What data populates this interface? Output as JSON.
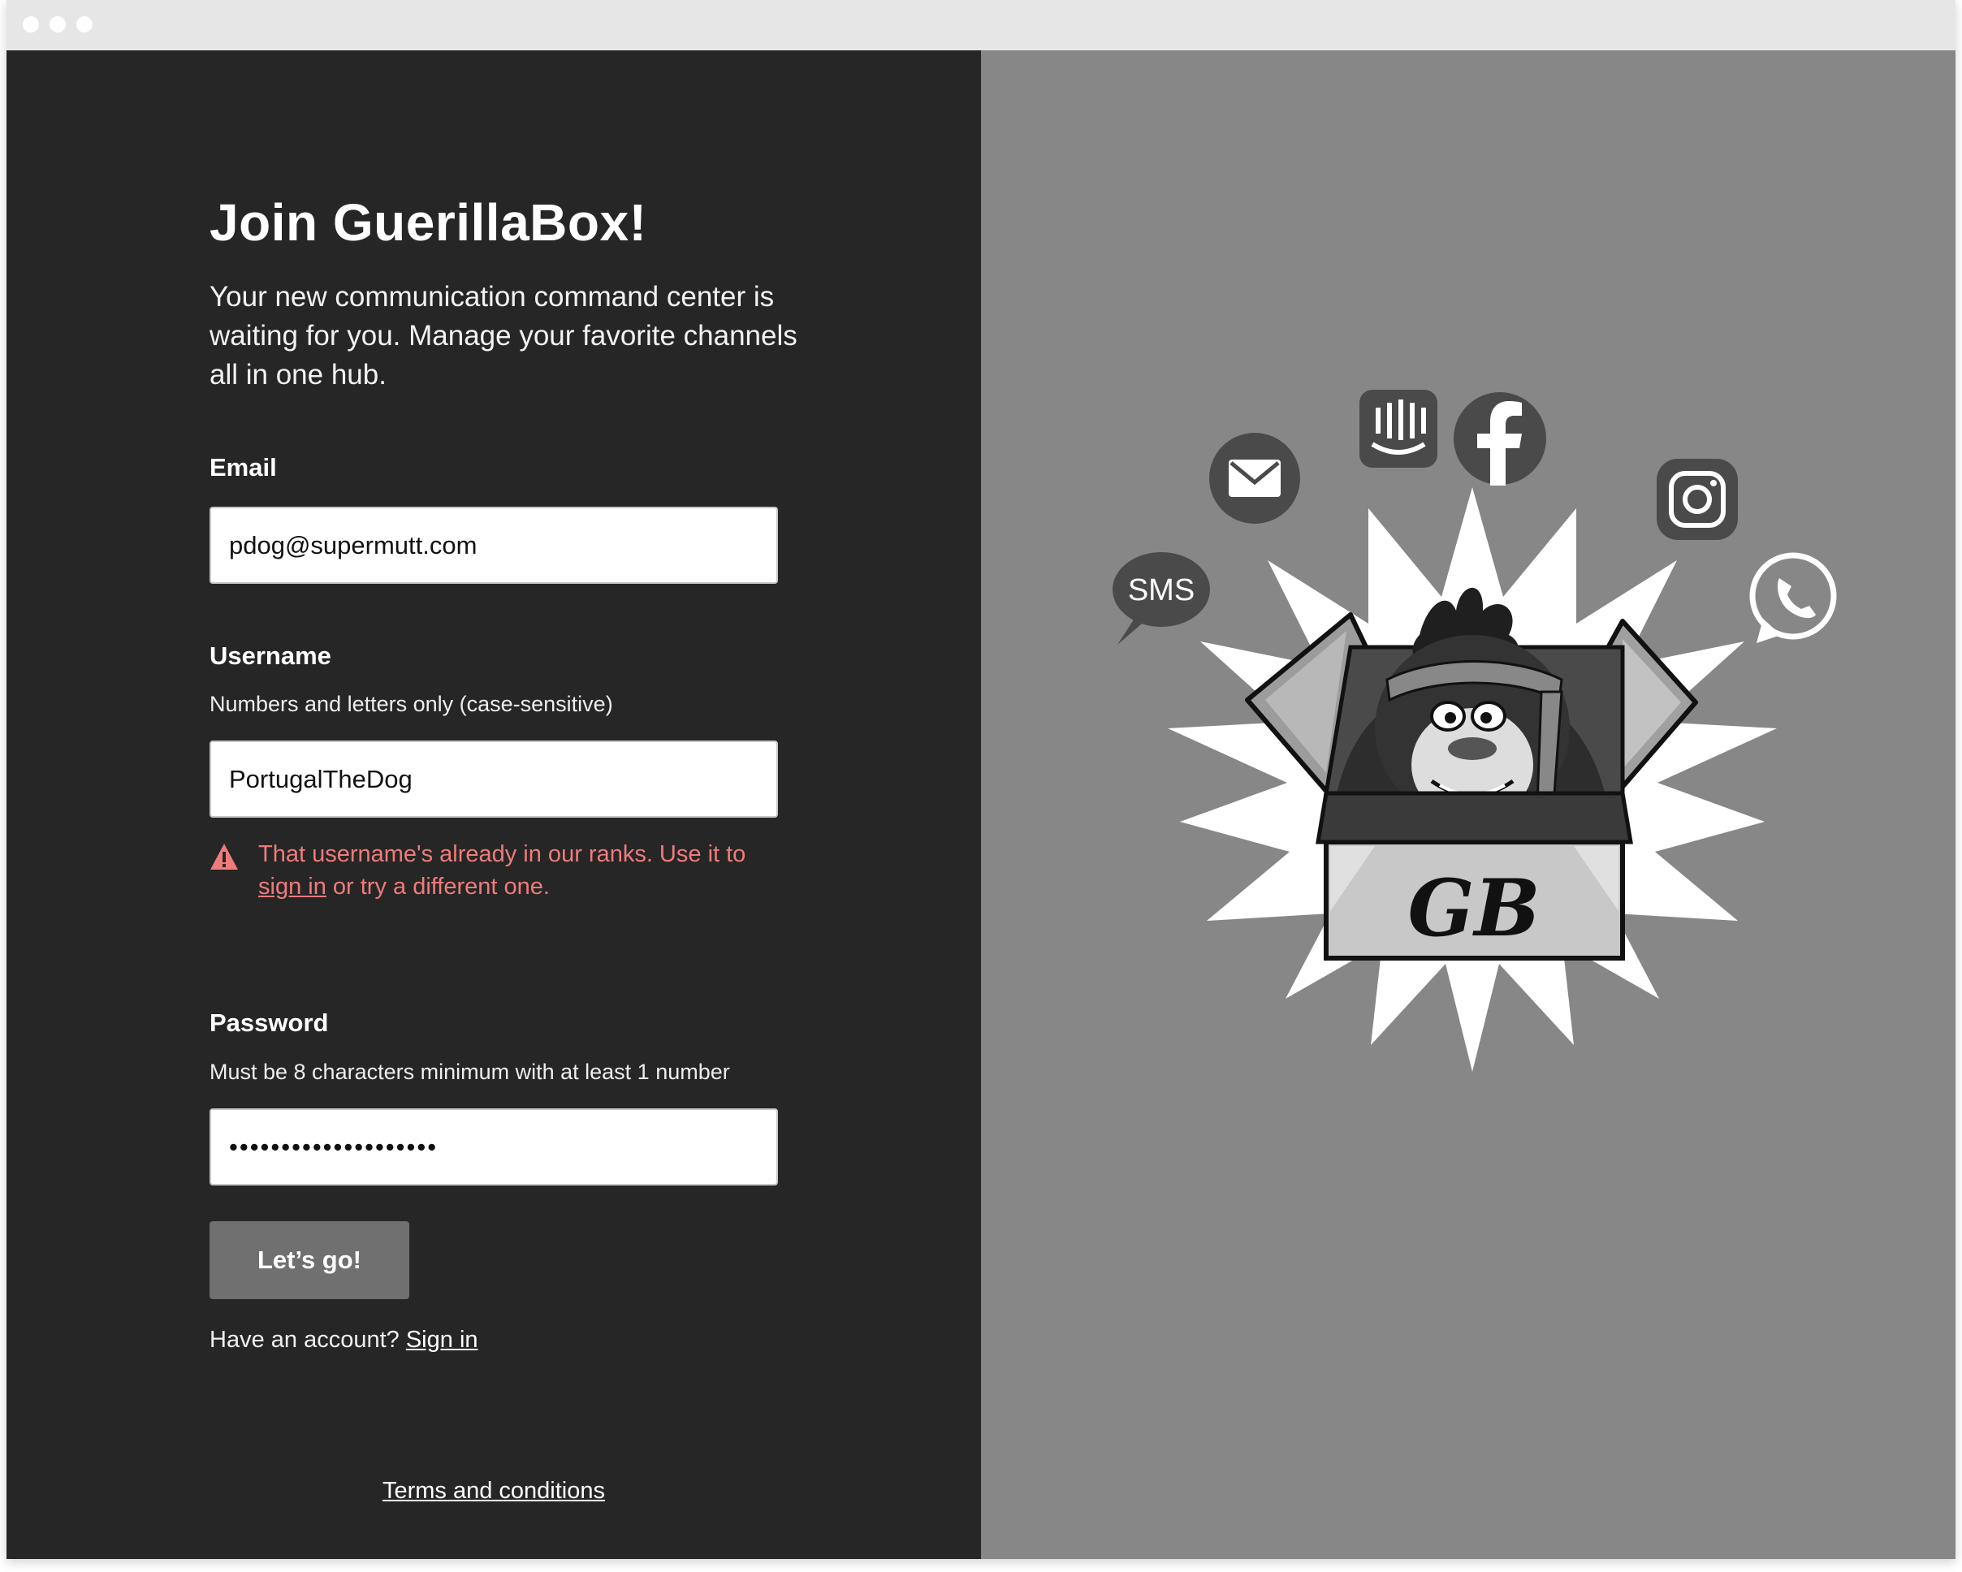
{
  "signup": {
    "title": "Join GuerillaBox!",
    "subtitle": "Your new communication command center is waiting for you. Manage your favorite channels all in one hub.",
    "email": {
      "label": "Email",
      "value": "pdog@supermutt.com"
    },
    "username": {
      "label": "Username",
      "hint": "Numbers and letters only (case-sensitive)",
      "value": "PortugalTheDog",
      "error_before": "That username's already in our ranks. Use it to",
      "error_link": "sign in",
      "error_after": "or try a different one."
    },
    "password": {
      "label": "Password",
      "hint": "Must be 8 characters minimum with at least 1 number",
      "value": "••••••••••••••••••••"
    },
    "submit_label": "Let’s go!",
    "account_prompt": "Have an account?",
    "signin_link": "Sign in",
    "terms_link": "Terms and conditions"
  },
  "illustration": {
    "sms_label": "SMS",
    "logo_text": "GB",
    "channel_icons": [
      "sms-icon",
      "mail-icon",
      "intercom-icon",
      "facebook-icon",
      "instagram-icon",
      "whatsapp-icon"
    ]
  },
  "colors": {
    "left_panel": "#262626",
    "right_panel": "#878787",
    "error": "#f07b7b",
    "button": "#707070"
  }
}
